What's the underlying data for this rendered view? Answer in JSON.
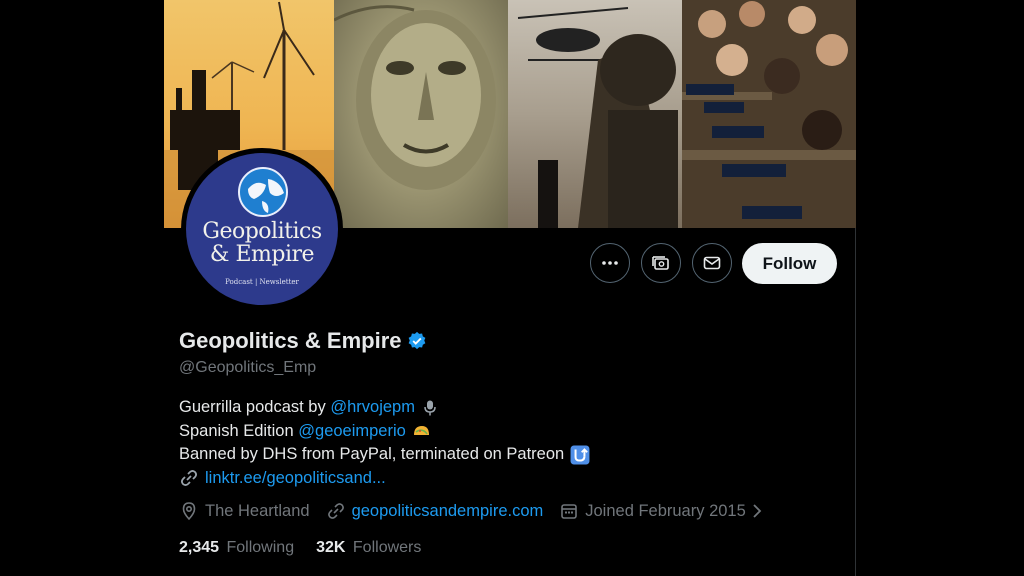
{
  "profile": {
    "display_name": "Geopolitics & Empire",
    "handle": "@Geopolitics_Emp",
    "verified": true,
    "avatar": {
      "line1": "Geopolitics",
      "line2": "& Empire",
      "tagline": "Podcast | Newsletter"
    },
    "bio": {
      "line1_prefix": "Guerrilla podcast by",
      "line1_link": "@hrvojepm",
      "line1_icon": "microphone-icon",
      "line2_prefix": "Spanish Edition",
      "line2_link": "@geoeimperio",
      "line2_icon": "taco-icon",
      "line3_text": "Banned by DHS from PayPal, terminated on Patreon",
      "line3_icon": "upside-down-arrow-icon",
      "line4_link": "linktr.ee/geopoliticsand...",
      "line4_icon": "link-icon"
    },
    "meta": {
      "location": "The Heartland",
      "website": "geopoliticsandempire.com",
      "joined": "Joined February 2015"
    },
    "stats": {
      "following_count": "2,345",
      "following_label": "Following",
      "followers_count": "32K",
      "followers_label": "Followers"
    }
  },
  "actions": {
    "more_icon": "more-icon",
    "subscribe_icon": "subscription-icon",
    "message_icon": "envelope-icon",
    "follow_label": "Follow"
  },
  "colors": {
    "background": "#000000",
    "link": "#1d9bf0",
    "muted": "#71767b",
    "follow_button": "#eff3f4",
    "avatar_bg": "#2d3a8c"
  }
}
